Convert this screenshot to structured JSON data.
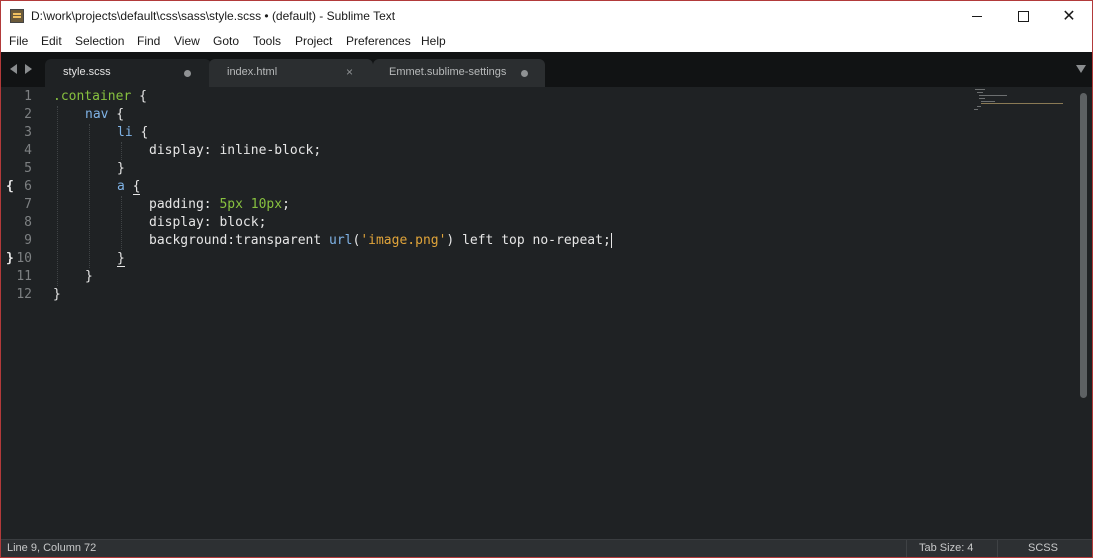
{
  "window": {
    "title": "D:\\work\\projects\\default\\css\\sass\\style.scss • (default) - Sublime Text"
  },
  "menu": [
    "File",
    "Edit",
    "Selection",
    "Find",
    "View",
    "Goto",
    "Tools",
    "Project",
    "Preferences",
    "Help"
  ],
  "tabs": [
    {
      "label": "style.scss",
      "active": true,
      "modified": true
    },
    {
      "label": "index.html",
      "active": false,
      "modified": false
    },
    {
      "label": "Emmet.sublime-settings",
      "active": false,
      "modified": true
    }
  ],
  "editor": {
    "line_numbers": [
      "1",
      "2",
      "3",
      "4",
      "5",
      "6",
      "7",
      "8",
      "9",
      "10",
      "11",
      "12"
    ],
    "fold_marks": {
      "open": "{",
      "close": "}"
    },
    "tokens": {
      "l1_selector": ".container",
      "l1_brace": " {",
      "l2_tag": "nav",
      "l2_brace": " {",
      "l3_tag": "li",
      "l3_brace": " {",
      "l4_text": "display: inline-block;",
      "l5_text": "}",
      "l6_tag": "a",
      "l6_brace": "{",
      "l7_prop": "padding: ",
      "l7_num1": "5px",
      "l7_num2": "10px",
      "l7_semi": ";",
      "l8_text": "display: block;",
      "l9_prop": "background:transparent ",
      "l9_fn": "url",
      "l9_open": "(",
      "l9_str": "'image.png'",
      "l9_rest": ") left top no-repeat;",
      "l10_text": "}",
      "l11_text": "}",
      "l12_text": "}"
    }
  },
  "status": {
    "position": "Line 9, Column 72",
    "tab_size": "Tab Size: 4",
    "syntax": "SCSS"
  },
  "colors": {
    "background": "#1f2224",
    "selector": "#87c13f",
    "tag": "#7fb3e6",
    "string": "#e0a43a",
    "number": "#87c13f"
  }
}
